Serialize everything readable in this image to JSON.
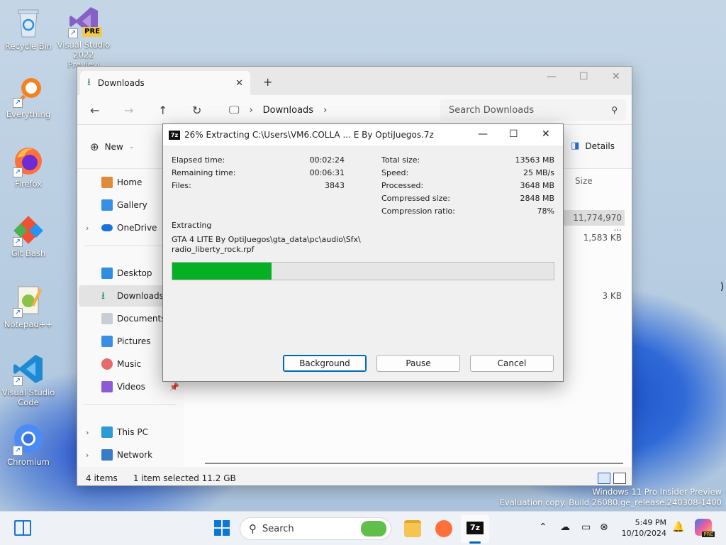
{
  "desktop": {
    "icons": [
      {
        "label": "Recycle Bin",
        "icon": "recycle-bin-icon"
      },
      {
        "label": "Visual Studio 2022 Preview",
        "icon": "visual-studio-icon",
        "badge": "PRE"
      },
      {
        "label": "Everything",
        "icon": "everything-search-icon"
      },
      {
        "label": "Firefox",
        "icon": "firefox-icon"
      },
      {
        "label": "Git Bash",
        "icon": "git-bash-icon"
      },
      {
        "label": "Notepad++",
        "icon": "notepad-plus-plus-icon"
      },
      {
        "label": "Visual Studio Code",
        "icon": "vscode-icon"
      },
      {
        "label": "Chromium",
        "icon": "chromium-icon"
      }
    ]
  },
  "explorer": {
    "tab_title": "Downloads",
    "new_tab": "+",
    "breadcrumb": "Downloads",
    "search_placeholder": "Search Downloads",
    "new_label": "New",
    "details_label": "Details",
    "size_header": "Size",
    "nav": [
      {
        "label": "Home",
        "icon": "home-icon"
      },
      {
        "label": "Gallery",
        "icon": "gallery-icon"
      },
      {
        "label": "OneDrive",
        "icon": "onedrive-icon"
      },
      {
        "label": "Desktop",
        "icon": "desktop-folder-icon"
      },
      {
        "label": "Downloads",
        "icon": "downloads-icon",
        "selected": true
      },
      {
        "label": "Documents",
        "icon": "documents-icon"
      },
      {
        "label": "Pictures",
        "icon": "pictures-icon"
      },
      {
        "label": "Music",
        "icon": "music-icon"
      },
      {
        "label": "Videos",
        "icon": "videos-icon"
      },
      {
        "label": "This PC",
        "icon": "this-pc-icon"
      },
      {
        "label": "Network",
        "icon": "network-icon"
      }
    ],
    "sizes": [
      "11,774,970 ...",
      "1,583 KB",
      "3 KB"
    ],
    "status": {
      "items": "4 items",
      "selected": "1 item selected  11.2 GB"
    }
  },
  "dialog": {
    "icon_text": "7z",
    "title": "26% Extracting C:\\Users\\VM6.COLLA ... E By OptiJuegos.7z",
    "left_stats": [
      {
        "label": "Elapsed time:",
        "value": "00:02:24"
      },
      {
        "label": "Remaining time:",
        "value": "00:06:31"
      },
      {
        "label": "Files:",
        "value": "3843"
      }
    ],
    "right_stats": [
      {
        "label": "Total size:",
        "value": "13563 MB"
      },
      {
        "label": "Speed:",
        "value": "25 MB/s"
      },
      {
        "label": "Processed:",
        "value": "3648 MB"
      },
      {
        "label": "Compressed size:",
        "value": "2848 MB"
      },
      {
        "label": "Compression ratio:",
        "value": "78%"
      }
    ],
    "extracting_label": "Extracting",
    "path_line1": "GTA 4 LITE By OptiJuegos\\gta_data\\pc\\audio\\Sfx\\",
    "path_line2": "radio_liberty_rock.rpf",
    "progress_percent": 26,
    "buttons": {
      "background": "Background",
      "pause": "Pause",
      "cancel": "Cancel"
    }
  },
  "watermark": {
    "line1": "Windows 11 Pro Insider Preview",
    "line2": "Evaluation copy. Build 26080.ge_release.240308-1400"
  },
  "taskbar": {
    "search_label": "Search",
    "time": "5:49 PM",
    "date": "10/10/2024",
    "active_app_text": "7z",
    "copilot_badge": "PRE"
  },
  "colors": {
    "progress_fill": "#06b025",
    "accent": "#0067c0",
    "wallpaper_blue": "#1d4fc8"
  }
}
